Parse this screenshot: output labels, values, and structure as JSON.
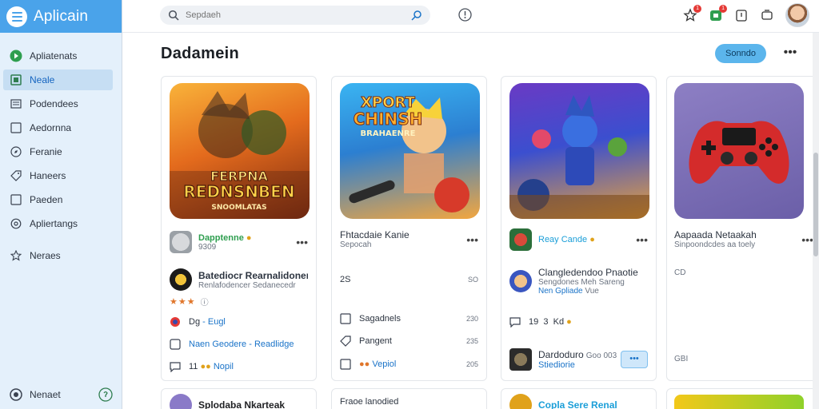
{
  "app": {
    "title": "Aplicain"
  },
  "sidebar": {
    "items": [
      {
        "label": "Apliatenats",
        "icon": "play-store-icon"
      },
      {
        "label": "Neale",
        "icon": "apps-icon",
        "active": true
      },
      {
        "label": "Podendees",
        "icon": "book-icon"
      },
      {
        "label": "Aedornna",
        "icon": "square-icon"
      },
      {
        "label": "Feranie",
        "icon": "compass-icon"
      },
      {
        "label": "Haneers",
        "icon": "tag-icon"
      },
      {
        "label": "Paeden",
        "icon": "square-icon"
      },
      {
        "label": "Apliertangs",
        "icon": "settings-icon"
      },
      {
        "label": "Neraes",
        "icon": "star-icon"
      }
    ],
    "bottom": {
      "label": "Nenaet",
      "icon": "account-icon",
      "right_icon": "help-icon"
    }
  },
  "topbar": {
    "search_placeholder": "Sepdaeh",
    "notification_badges": [
      "1",
      "1"
    ]
  },
  "main": {
    "title": "Dadamein",
    "sort_button": "Sonndo"
  },
  "cards": [
    {
      "art_text_1": "FERPNA",
      "art_text_2": "REDNSNBEN",
      "art_text_3": "SNOOMLATAS",
      "dev_name": "Dapptenne",
      "dev_sub": "9309",
      "item_title": "Batediocr Rearnalidonena",
      "item_sub": "Renlafodencer Sedanecedr",
      "rating_icon_label": "",
      "tag1_a": "Dg",
      "tag1_b": "-",
      "tag1_c": "Eugl",
      "link_a": "Naen Geodere",
      "link_b": "-",
      "link_c": "Readlidge",
      "foot_count": "11",
      "foot_link": "Nopil"
    },
    {
      "art_text_1": "XPORT",
      "art_text_2": "CHINSH",
      "art_text_3": "BRAHAENRE",
      "title": "Fhtacdaie Kanie",
      "sub": "Sepocah",
      "stat_label": "2S",
      "stat_val": "SO",
      "rows": [
        {
          "label": "Sagadnels",
          "val": "230"
        },
        {
          "label": "Pangent",
          "val": "235"
        },
        {
          "label": "Vepiol",
          "val": "205"
        }
      ]
    },
    {
      "dev_name": "Reay Cande",
      "item_title": "Clangledendoo Pnaotie",
      "item_sub": "Sengdones Meh Sareng",
      "link_a": "Nen",
      "link_b": "Gpliade",
      "link_c": "Vue",
      "stat_a": "19",
      "stat_b": "3",
      "stat_c": "Kd",
      "owner": "Dardoduro",
      "owner_sub": "Goo 003",
      "owner_link": "Stiediorie",
      "dots": "•••"
    },
    {
      "title": "Aapaada Netaakah",
      "sub": "Sinpoondcdes aa toely",
      "icon_label": "CD",
      "foot_label": "GBI"
    }
  ],
  "cards_row2": [
    {
      "title": "Splodaba Nkarteak"
    },
    {
      "title": "Fraoe lanodied"
    },
    {
      "title": "Copla Sere Renal"
    },
    {
      "title": ""
    }
  ]
}
